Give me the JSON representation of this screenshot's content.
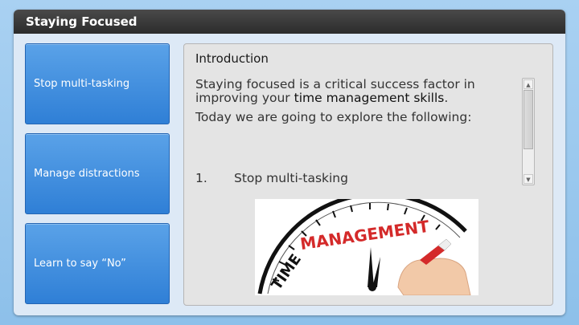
{
  "window": {
    "title": "Staying Focused"
  },
  "nav": {
    "items": [
      {
        "label": "Stop multi-tasking"
      },
      {
        "label": "Manage distractions"
      },
      {
        "label": "Learn to say “No”"
      }
    ]
  },
  "content": {
    "heading": "Introduction",
    "paragraph1": "Staying focused is a critical success factor in improving your",
    "paragraph1_emphasis": "time management skills",
    "paragraph1_end": ".",
    "paragraph2": "Today we are going to explore the following:",
    "list": [
      {
        "number": "1.",
        "text": "Stop multi-tasking"
      }
    ],
    "image": {
      "word1": "TIME",
      "word2": "MANAGEMENT"
    }
  },
  "colors": {
    "titlebar": "#333333",
    "nav_button": "#3d8bdc",
    "management_text": "#d42a2a",
    "background": "#a9d1f2"
  }
}
